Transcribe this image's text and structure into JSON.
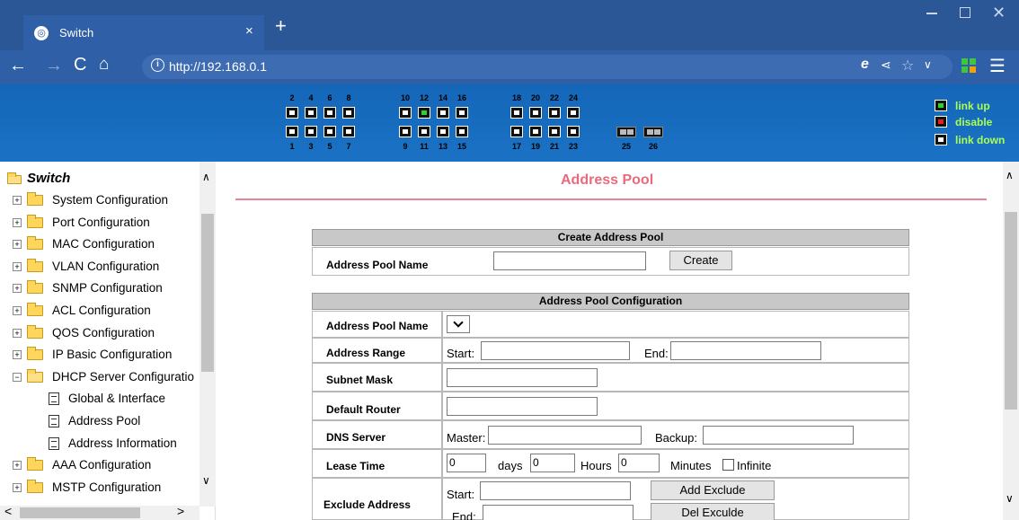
{
  "browser": {
    "tab_title": "Switch",
    "tab_close": "×",
    "new_tab": "+",
    "url": "http://192.168.0.1",
    "icons": [
      "back-icon",
      "forward-icon",
      "reload-icon",
      "home-icon",
      "info-icon",
      "ie-icon",
      "share-icon",
      "star-icon",
      "chevron-down-icon",
      "extensions-icon",
      "menu-icon"
    ]
  },
  "switch_panel": {
    "top_numbers": [
      "2",
      "4",
      "6",
      "8",
      "10",
      "12",
      "14",
      "16",
      "18",
      "20",
      "22",
      "24"
    ],
    "bottom_numbers": [
      "1",
      "3",
      "5",
      "7",
      "9",
      "11",
      "13",
      "15",
      "17",
      "19",
      "21",
      "23",
      "25",
      "26"
    ],
    "link_up_ports": [
      "12"
    ],
    "legend": {
      "up": "link up",
      "disable": "disable",
      "down": "link down"
    },
    "colors": {
      "up": "#2ed12e",
      "disable": "#e3211c",
      "down": "#ffffff",
      "legend_text": "#aaff55"
    }
  },
  "tree": {
    "root": "Switch",
    "items": [
      "System Configuration",
      "Port Configuration",
      "MAC Configuration",
      "VLAN Configuration",
      "SNMP Configuration",
      "ACL Configuration",
      "QOS Configuration",
      "IP Basic Configuration",
      "DHCP Server Configuratio",
      "Global & Interface",
      "Address Pool",
      "Address Information",
      "AAA Configuration",
      "MSTP Configuration"
    ]
  },
  "page": {
    "title": "Address Pool",
    "title_color": "#e96a7d",
    "create_section": {
      "header": "Create Address Pool",
      "name_label": "Address Pool Name",
      "name_value": "",
      "create_button": "Create"
    },
    "config_section": {
      "header": "Address Pool Configuration",
      "pool_name_label": "Address Pool Name",
      "range_label": "Address Range",
      "start_label": "Start:",
      "end_label": "End:",
      "subnet_label": "Subnet Mask",
      "router_label": "Default Router",
      "dns_label": "DNS Server",
      "master_label": "Master:",
      "backup_label": "Backup:",
      "lease_label": "Lease Time",
      "lease_days": "0",
      "days_label": "days",
      "lease_hours": "0",
      "hours_label": "Hours",
      "lease_minutes": "0",
      "minutes_label": "Minutes",
      "infinite_label": "Infinite",
      "exclude_label": "Exclude Address",
      "exclude_start_label": "Start:",
      "exclude_end_label": "End:",
      "add_exclude_button": "Add Exclude",
      "del_exclude_button": "Del Exculde"
    }
  }
}
